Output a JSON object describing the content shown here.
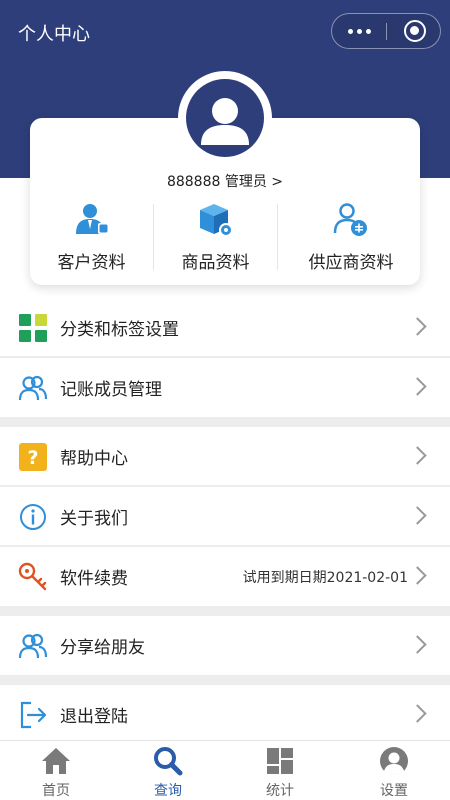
{
  "header": {
    "title": "个人中心"
  },
  "profile": {
    "user_line": "888888 管理员 >"
  },
  "quick_actions": [
    {
      "label": "客户资料",
      "icon": "customer-icon"
    },
    {
      "label": "商品资料",
      "icon": "product-box-icon"
    },
    {
      "label": "供应商资料",
      "icon": "supplier-icon"
    }
  ],
  "menu": [
    {
      "label": "分类和标签设置",
      "icon": "category-grid-icon"
    },
    {
      "label": "记账成员管理",
      "icon": "members-icon"
    },
    {
      "label": "帮助中心",
      "icon": "help-icon"
    },
    {
      "label": "关于我们",
      "icon": "info-icon"
    },
    {
      "label": "软件续费",
      "icon": "renew-key-icon",
      "value": "试用到期日期2021-02-01"
    },
    {
      "label": "分享给朋友",
      "icon": "share-friends-icon"
    },
    {
      "label": "退出登陆",
      "icon": "logout-icon"
    }
  ],
  "tabbar": [
    {
      "label": "首页",
      "icon": "home-icon"
    },
    {
      "label": "查询",
      "icon": "search-icon",
      "active": true
    },
    {
      "label": "统计",
      "icon": "stats-icon"
    },
    {
      "label": "设置",
      "icon": "settings-user-icon"
    }
  ],
  "colors": {
    "primary": "#2d3e7a",
    "accent_blue": "#2f8fd8",
    "active_tab": "#2a5caa",
    "help_yellow": "#f2b21b",
    "key_orange": "#e0531f",
    "grid_green": "#1f9f5a"
  }
}
